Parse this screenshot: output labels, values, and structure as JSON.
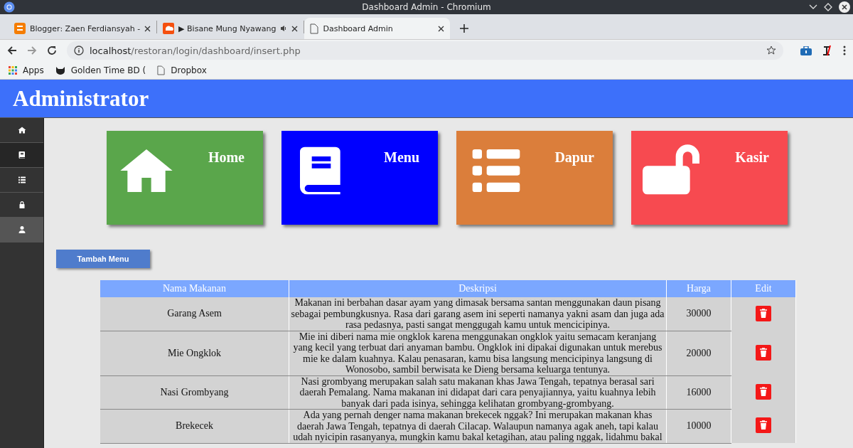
{
  "window": {
    "title": "Dashboard Admin - Chromium"
  },
  "tabs": [
    {
      "title": "Blogger: Zaen Ferdiansyah -",
      "kind": "blogger",
      "playing": false,
      "selected": false
    },
    {
      "title": "▶ Bisane Mung Nyawang",
      "kind": "music",
      "playing": true,
      "selected": false
    },
    {
      "title": "Dashboard Admin",
      "kind": "page",
      "playing": false,
      "selected": true
    }
  ],
  "address": {
    "host": "localhost",
    "path": "/restoran/login/dashboard/insert.php"
  },
  "bookmarks": [
    {
      "label": "Apps",
      "kind": "apps"
    },
    {
      "label": "Golden Time BD (",
      "kind": "cat"
    },
    {
      "label": "Dropbox",
      "kind": "page"
    }
  ],
  "header": {
    "title": "Administrator"
  },
  "sidebar": {
    "items": [
      {
        "kind": "home",
        "selected": false,
        "hovered": false
      },
      {
        "kind": "book",
        "selected": true,
        "hovered": false
      },
      {
        "kind": "list",
        "selected": false,
        "hovered": false
      },
      {
        "kind": "lock",
        "selected": false,
        "hovered": false
      },
      {
        "kind": "user",
        "selected": false,
        "hovered": true
      }
    ]
  },
  "cards": [
    {
      "label": "Home",
      "kind": "home",
      "color": "#5aa64b"
    },
    {
      "label": "Menu",
      "kind": "book",
      "color": "#0000ff"
    },
    {
      "label": "Dapur",
      "kind": "list",
      "color": "#db7e3b"
    },
    {
      "label": "Kasir",
      "kind": "unlock",
      "color": "#f74a50"
    }
  ],
  "add_button": "Tambah Menu",
  "table": {
    "columns": [
      "Nama Makanan",
      "Deskripsi",
      "Harga",
      "Edit"
    ],
    "rows": [
      {
        "name": "Garang Asem",
        "description": "Makanan ini berbahan dasar ayam yang dimasak bersama santan menggunakan daun pisang sebagai pembungkusnya. Rasa dari garang asem ini seperti namanya yakni asam dan juga ada rasa pedasnya, pasti sangat menggugah kamu untuk mencicipinya.",
        "price": "30000"
      },
      {
        "name": "Mie Ongklok",
        "description": "Mie ini diberi nama mie ongklok karena menggunakan ongklok yaitu semacam keranjang yang kecil yang terbuat dari anyaman bambu. Ongklok ini dipakai digunakan untuk merebus mie ke dalam kuahnya. Kalau penasaran, kamu bisa langsung mencicipinya langsung di Wonosobo, sambil berwisata ke Dieng bersama keluarga tentunya.",
        "price": "20000"
      },
      {
        "name": "Nasi Grombyang",
        "description": "Nasi grombyang merupakan salah satu makanan khas Jawa Tengah, tepatnya berasal sari daerah Pemalang. Nama makanan ini didapat dari cara penyajiannya, yaitu kuahnya lebih banyak dari pada isinya, sehingga kelihatan grombyang-grombyang.",
        "price": "16000"
      },
      {
        "name": "Brekecek",
        "description": "Ada yang pernah denger nama makanan brekecek nggak? Ini merupakan makanan khas daerah Jawa Tengah, tepatnya di daerah Cilacap. Walaupun namanya agak aneh, tapi kalau udah nyicipin rasanyanya, mungkin kamu bakal ketagihan, atau paling nggak, lidahmu bakal",
        "price": "10000"
      }
    ]
  }
}
